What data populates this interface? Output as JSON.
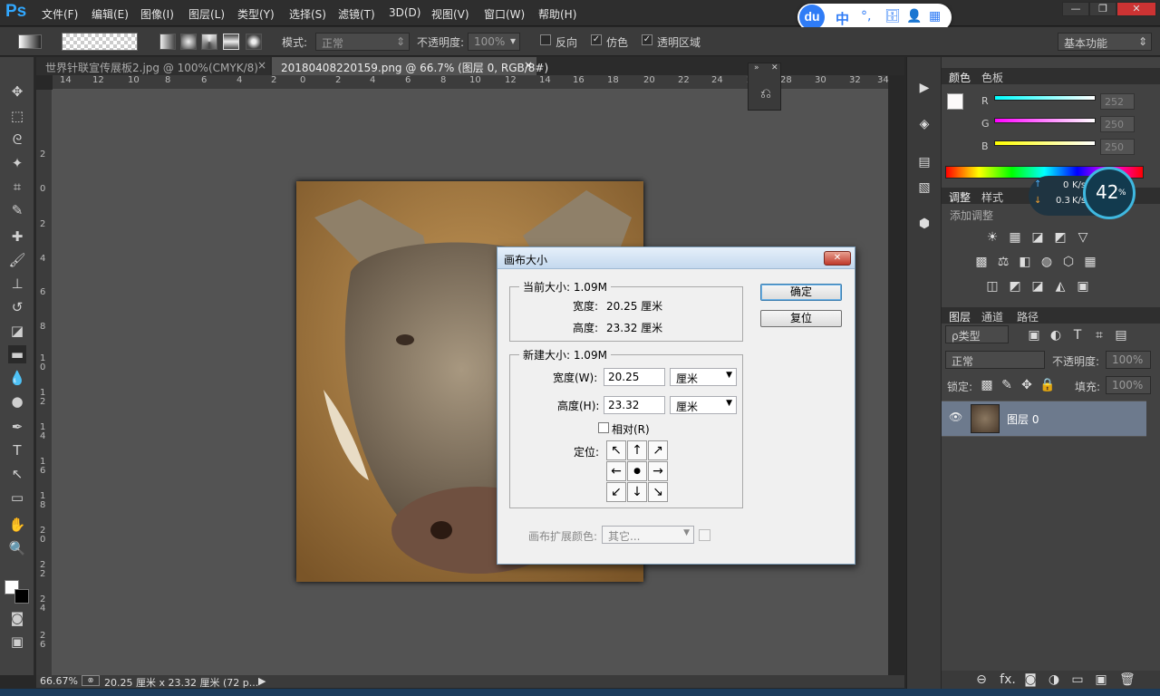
{
  "app": {
    "logo": "Ps"
  },
  "menu": [
    "文件(F)",
    "编辑(E)",
    "图像(I)",
    "图层(L)",
    "类型(Y)",
    "选择(S)",
    "滤镜(T)",
    "3D(D)",
    "视图(V)",
    "窗口(W)",
    "帮助(H)"
  ],
  "window_controls": {
    "minimize": "—",
    "restore": "❐",
    "close": "✕"
  },
  "options": {
    "mode_label": "模式:",
    "mode_value": "正常",
    "opacity_label": "不透明度:",
    "opacity_value": "100%",
    "reverse_label": "反向",
    "dither_label": "仿色",
    "transparency_label": "透明区域",
    "workspace": "基本功能"
  },
  "tabs": [
    {
      "label": "世界针联宣传展板2.jpg @ 100%(CMYK/8)",
      "close": "×"
    },
    {
      "label": "20180408220159.png @ 66.7% (图层 0, RGB/8#)",
      "close": "×"
    }
  ],
  "ruler_top": [
    "14",
    "12",
    "10",
    "8",
    "6",
    "4",
    "2",
    "0",
    "2",
    "4",
    "6",
    "8",
    "10",
    "12",
    "14",
    "16",
    "18",
    "20",
    "22",
    "24",
    "26",
    "28",
    "30",
    "32",
    "34"
  ],
  "ruler_left": [
    "2",
    "0",
    "2",
    "4",
    "6",
    "8",
    "1 0",
    "1 2",
    "1 4",
    "1 6",
    "1 8",
    "2 0",
    "2 2",
    "2 4",
    "2 6"
  ],
  "status": {
    "zoom": "66.67%",
    "doc_info": "20.25 厘米 x 23.32 厘米 (72 p...",
    "arrow": "▶"
  },
  "color_panel": {
    "tabs": [
      "颜色",
      "色板"
    ],
    "channels": [
      {
        "label": "R",
        "value": "252"
      },
      {
        "label": "G",
        "value": "250"
      },
      {
        "label": "B",
        "value": "250"
      }
    ]
  },
  "adjust_panel": {
    "tabs": [
      "调整",
      "样式"
    ],
    "add_label": "添加调整",
    "icons_row1": [
      "☀",
      "▦",
      "◪",
      "◩",
      "▽"
    ],
    "icons_row2": [
      "▩",
      "⚖",
      "◧",
      "◍",
      "⬡",
      "▦"
    ],
    "icons_row3": [
      "◫",
      "◩",
      "◪",
      "◭",
      "▣"
    ]
  },
  "net_widget": {
    "up": "0",
    "down": "0.3",
    "unit": "K/s",
    "percent": "42",
    "percent_sign": "%"
  },
  "layers_panel": {
    "tabs": [
      "图层",
      "通道",
      "路径"
    ],
    "kind_label": "ρ类型",
    "blend": "正常",
    "opacity_label": "不透明度:",
    "opacity_value": "100%",
    "lock_label": "锁定:",
    "fill_label": "填充:",
    "fill_value": "100%",
    "layers": [
      {
        "name": "图层 0",
        "visible": "👁"
      }
    ],
    "footer": [
      "⊖",
      "fx.",
      "◙",
      "◑",
      "▭",
      "▣",
      "🗑"
    ]
  },
  "dialog": {
    "title": "画布大小",
    "close": "✕",
    "current_title": "当前大小: 1.09M",
    "current_width_label": "宽度:",
    "current_width_value": "20.25 厘米",
    "current_height_label": "高度:",
    "current_height_value": "23.32 厘米",
    "new_title": "新建大小: 1.09M",
    "width_label": "宽度(W):",
    "width_value": "20.25",
    "width_unit": "厘米",
    "height_label": "高度(H):",
    "height_value": "23.32",
    "height_unit": "厘米",
    "relative_label": "相对(R)",
    "anchor_label": "定位:",
    "anchor": [
      "↖",
      "↑",
      "↗",
      "←",
      "●",
      "→",
      "↙",
      "↓",
      "↘"
    ],
    "extension_label": "画布扩展颜色:",
    "extension_value": "其它...",
    "ok": "确定",
    "reset": "复位"
  },
  "baidu": {
    "logo": "du",
    "zhong": "中",
    "items": [
      "°,",
      "🗄",
      "👤",
      "▦"
    ]
  },
  "colors": {
    "accent": "#31a8ff",
    "selected_layer": "#6d7a8d",
    "dialog_bg": "#f0f0f0"
  }
}
